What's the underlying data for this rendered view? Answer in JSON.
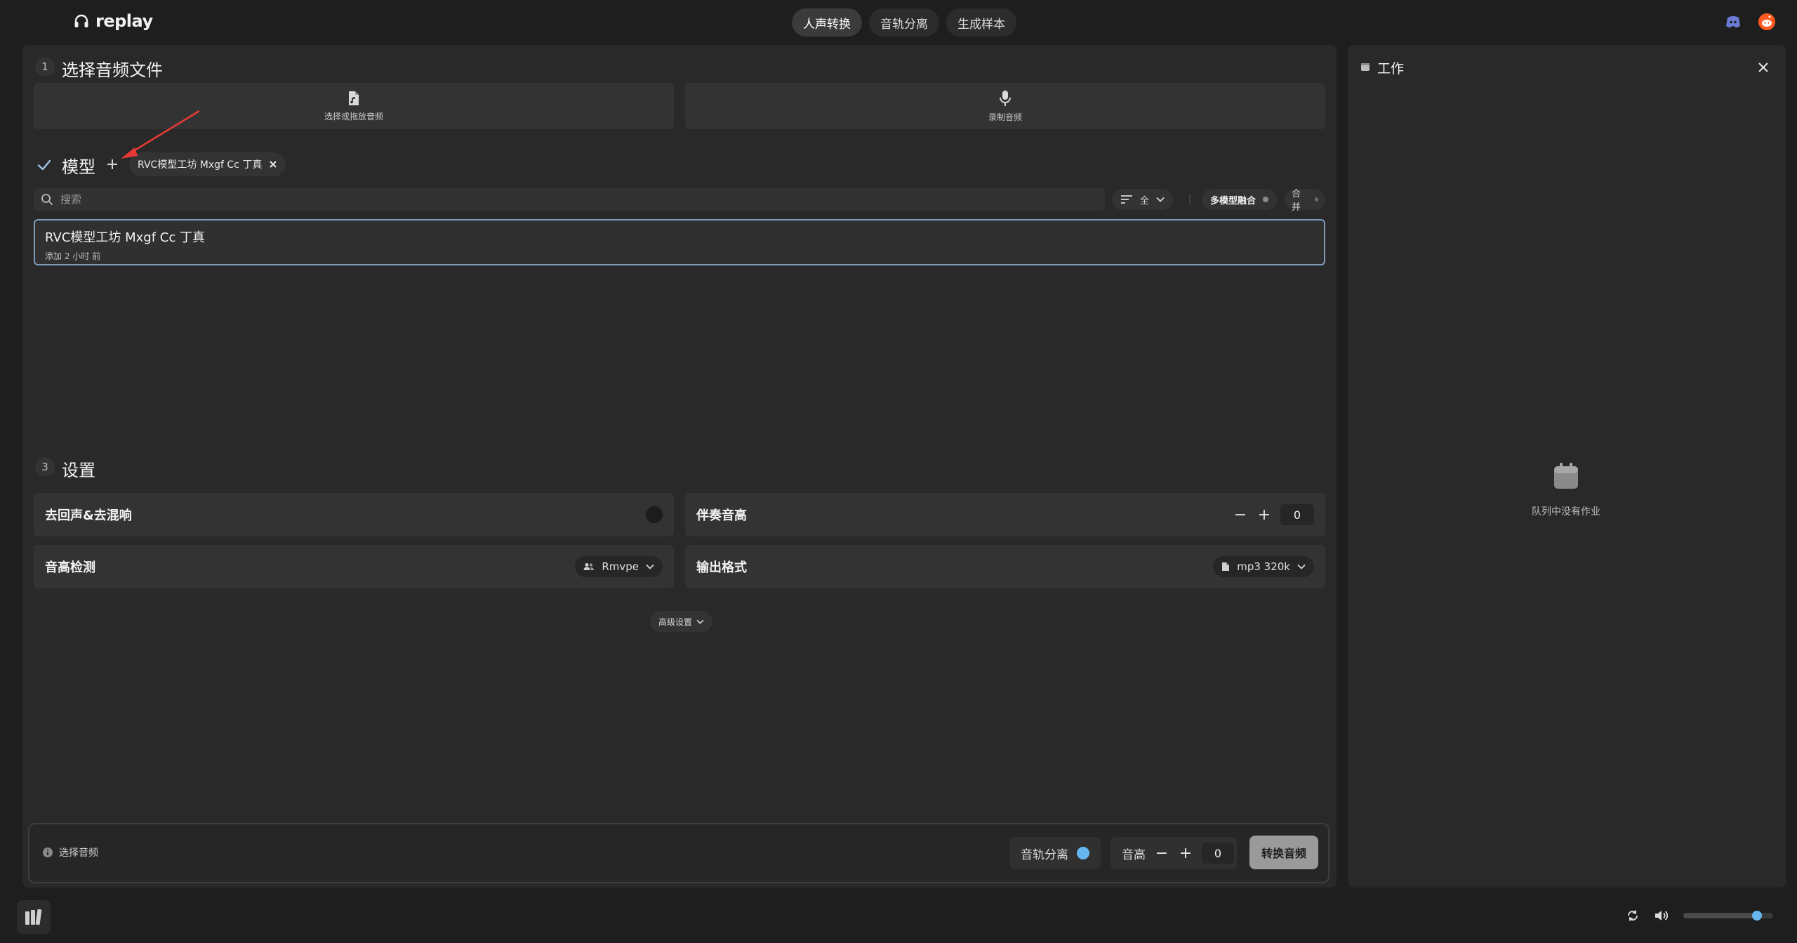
{
  "app": {
    "name": "replay"
  },
  "nav": {
    "tabs": [
      "人声转换",
      "音轨分离",
      "生成样本"
    ],
    "active": 0
  },
  "section1": {
    "number": "1",
    "title": "选择音频文件",
    "upload_label": "选择或拖放音频",
    "record_label": "录制音频"
  },
  "model_section": {
    "title": "模型",
    "selected_chip": "RVC模型工坊 Mxgf Cc 丁真",
    "search_placeholder": "搜索",
    "filter_label": "全",
    "blend_label": "多模型融合",
    "merge_label": "合并",
    "models": [
      {
        "name": "RVC模型工坊 Mxgf Cc 丁真",
        "added": "添加 2 小时 前"
      }
    ]
  },
  "settings": {
    "number": "3",
    "title": "设置",
    "dereverb_label": "去回声&去混响",
    "backing_pitch_label": "伴奏音高",
    "backing_pitch_value": "0",
    "pitch_detect_label": "音高检测",
    "pitch_detect_value": "Rmvpe",
    "output_format_label": "输出格式",
    "output_format_value": "mp3 320k",
    "advanced_label": "高级设置"
  },
  "bottom": {
    "hint": "选择音频",
    "stem_label": "音轨分离",
    "pitch_label": "音高",
    "pitch_value": "0",
    "convert_label": "转换音频"
  },
  "jobs": {
    "title": "工作",
    "empty": "队列中没有作业"
  },
  "player": {
    "volume": 0.82
  },
  "colors": {
    "accent": "#66b7f0",
    "selected_border": "#7f9bb8",
    "arrow": "#e53935"
  }
}
